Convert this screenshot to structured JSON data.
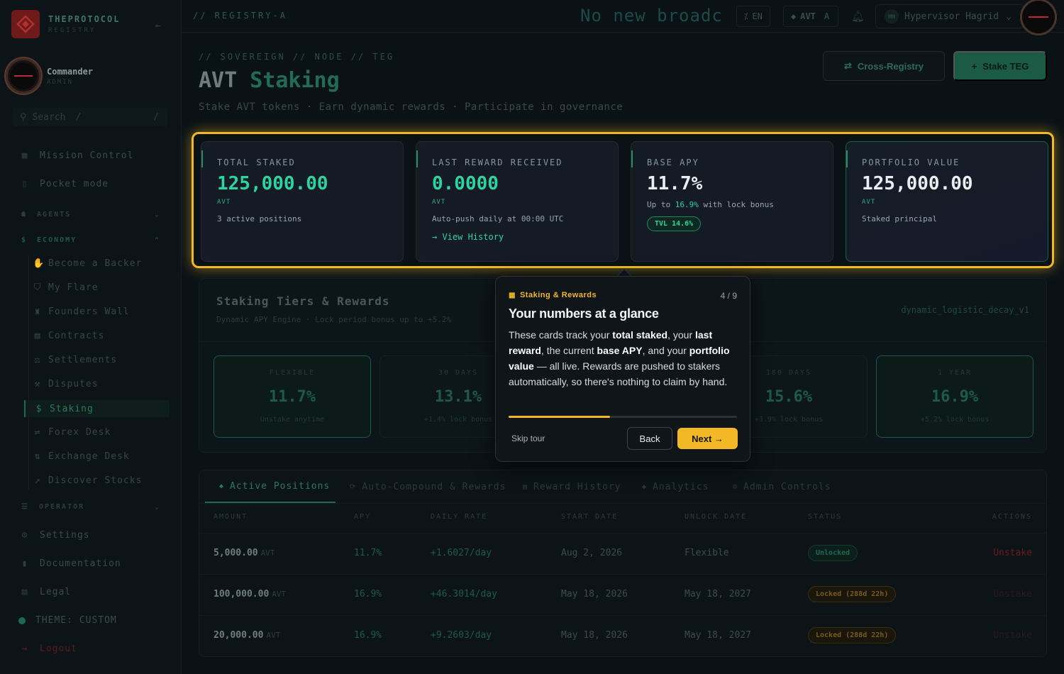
{
  "brand": {
    "name": "THEPROTOCOL",
    "sub": "REGISTRY"
  },
  "profile": {
    "name": "Commander",
    "role": "ADMIN"
  },
  "search": {
    "placeholder": "Search",
    "shortcut": "/",
    "shortcut2": "/"
  },
  "nav": {
    "top": [
      {
        "label": "Mission Control",
        "icon": "grid-icon"
      },
      {
        "label": "Pocket mode",
        "icon": "phone-icon"
      }
    ],
    "sections": {
      "agents": "AGENTS",
      "economy": "ECONOMY",
      "operator": "OPERATOR"
    },
    "economy_items": [
      {
        "label": "Become a Backer",
        "icon": "hand-coin-icon"
      },
      {
        "label": "My Flare",
        "icon": "shield-icon"
      },
      {
        "label": "Founders Wall",
        "icon": "trophy-icon"
      },
      {
        "label": "Contracts",
        "icon": "document-icon"
      },
      {
        "label": "Settlements",
        "icon": "scale-icon"
      },
      {
        "label": "Disputes",
        "icon": "gavel-icon"
      },
      {
        "label": "Staking",
        "icon": "dollar-icon"
      },
      {
        "label": "Forex Desk",
        "icon": "exchange-icon"
      },
      {
        "label": "Exchange Desk",
        "icon": "swap-icon"
      },
      {
        "label": "Discover Stocks",
        "icon": "chart-icon"
      }
    ],
    "bottom": [
      {
        "label": "Settings",
        "icon": "gear-icon"
      },
      {
        "label": "Documentation",
        "icon": "book-icon"
      },
      {
        "label": "Legal",
        "icon": "legal-icon"
      },
      {
        "label": "THEME: CUSTOM",
        "icon": "theme-dot-icon"
      },
      {
        "label": "Logout",
        "icon": "logout-icon"
      }
    ]
  },
  "topbar": {
    "crumb": "// REGISTRY-A",
    "broadcast": "No new broadc",
    "lang": "EN",
    "token": "AVT",
    "token_suffix": "A",
    "user": "Hypervisor Hagrid",
    "user_initials": "HH"
  },
  "header": {
    "crumb": "// SOVEREIGN // NODE // TEG",
    "title_a": "AVT",
    "title_b": "Staking",
    "subtitle": "Stake AVT tokens · Earn dynamic rewards · Participate in governance",
    "cross_label": "Cross-Registry",
    "stake_label": "Stake TEG"
  },
  "cards": [
    {
      "label": "TOTAL STAKED",
      "value": "125,000.00",
      "unit": "AVT",
      "note": "3 active positions"
    },
    {
      "label": "LAST REWARD RECEIVED",
      "value": "0.0000",
      "unit": "AVT",
      "note": "Auto-push daily at 00:00 UTC",
      "link": "→ View History"
    },
    {
      "label": "BASE APY",
      "value": "11.7%",
      "note_pre": "Up to",
      "note_hl": "16.9%",
      "note_post": "with lock bonus",
      "badge": "TVL 14.6%"
    },
    {
      "label": "PORTFOLIO VALUE",
      "value": "125,000.00",
      "unit": "AVT",
      "note": "Staked principal"
    }
  ],
  "tiers": {
    "title": "Staking Tiers & Rewards",
    "subtitle": "Dynamic APY Engine · Lock period bonus up to +5.2%",
    "engine": "dynamic_logistic_decay_v1",
    "items": [
      {
        "label": "FLEXIBLE",
        "apy": "11.7%",
        "bonus": "Unstake anytime"
      },
      {
        "label": "30 DAYS",
        "apy": "13.1%",
        "bonus": "+1.4% lock bonus"
      },
      {
        "label": "180 DAYS",
        "apy": "15.6%",
        "bonus": "+3.9% lock bonus"
      },
      {
        "label": "1 YEAR",
        "apy": "16.9%",
        "bonus": "+5.2% lock bonus"
      }
    ]
  },
  "positions": {
    "tabs": [
      "Active Positions",
      "Auto-Compound & Rewards",
      "Reward History",
      "Analytics",
      "Admin Controls"
    ],
    "columns": [
      "AMOUNT",
      "APY",
      "DAILY RATE",
      "START DATE",
      "UNLOCK DATE",
      "STATUS",
      "ACTIONS"
    ],
    "rows": [
      {
        "amount": "5,000.00",
        "unit": "AVT",
        "apy": "11.7%",
        "daily": "+1.6027/day",
        "start": "Aug 2, 2026",
        "unlock": "Flexible",
        "status": "Unlocked",
        "action": "Unstake"
      },
      {
        "amount": "100,000.00",
        "unit": "AVT",
        "apy": "16.9%",
        "daily": "+46.3014/day",
        "start": "May 18, 2026",
        "unlock": "May 18, 2027",
        "status": "Locked (288d 22h)",
        "action": "Unstake"
      },
      {
        "amount": "20,000.00",
        "unit": "AVT",
        "apy": "16.9%",
        "daily": "+9.2603/day",
        "start": "May 18, 2026",
        "unlock": "May 18, 2027",
        "status": "Locked (288d 22h)",
        "action": "Unstake"
      }
    ]
  },
  "tour": {
    "kicker": "Staking & Rewards",
    "step": "4 / 9",
    "progress": 0.444,
    "title": "Your numbers at a glance",
    "body": [
      {
        "t": "These cards track your "
      },
      {
        "t": "total staked",
        "b": true
      },
      {
        "t": ", your "
      },
      {
        "t": "last reward",
        "b": true
      },
      {
        "t": ", the current "
      },
      {
        "t": "base APY",
        "b": true
      },
      {
        "t": ", and your "
      },
      {
        "t": "portfolio value",
        "b": true
      },
      {
        "t": " — all live. Rewards are pushed to stakers automatically, so there's nothing to claim by hand."
      }
    ],
    "skip": "Skip tour",
    "back": "Back",
    "next": "Next →"
  },
  "colors": {
    "accent": "#2ed4a0",
    "highlight": "#f2b825",
    "danger": "#6a1a1e"
  }
}
